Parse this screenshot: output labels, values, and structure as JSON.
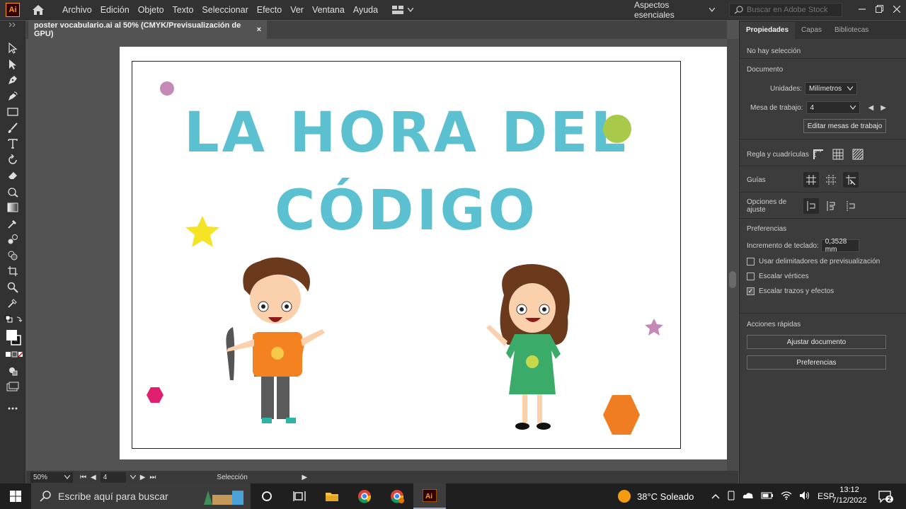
{
  "app": {
    "logo": "Ai"
  },
  "menu": [
    "Archivo",
    "Edición",
    "Objeto",
    "Texto",
    "Seleccionar",
    "Efecto",
    "Ver",
    "Ventana",
    "Ayuda"
  ],
  "workspace": "Aspectos esenciales",
  "stock_search": {
    "placeholder": "Buscar en Adobe Stock"
  },
  "document_tab": {
    "title": "poster vocabulario.ai al 50% (CMYK/Previsualización de GPU)",
    "close": "×"
  },
  "artboard": {
    "title_line1": "LA HORA DEL",
    "title_line2": "CÓDIGO",
    "colors": {
      "title": "#5bc0d0",
      "green_circle": "#a8c94a",
      "purple": "#c48ab5",
      "yellow_star": "#f5e326",
      "orange_hex": "#f07d22",
      "pink_hex": "#e0206e"
    }
  },
  "status": {
    "zoom": "50%",
    "artboard_number": "4",
    "tool": "Selección"
  },
  "panel": {
    "tabs": [
      "Propiedades",
      "Capas",
      "Bibliotecas"
    ],
    "selection_state": "No hay selección",
    "document": {
      "title": "Documento",
      "units_label": "Unidades:",
      "units_value": "Milímetros",
      "artboard_label": "Mesa de trabajo:",
      "artboard_value": "4",
      "edit_button": "Editar mesas de trabajo"
    },
    "rulers_label": "Regla y cuadrículas",
    "guides_label": "Guías",
    "snap_label": "Opciones de ajuste",
    "preferences": {
      "title": "Preferencias",
      "keyboard_increment_label": "Incremento de teclado:",
      "keyboard_increment_value": "0,3528 mm",
      "checkboxes": [
        {
          "label": "Usar delimitadores de previsualización",
          "checked": false
        },
        {
          "label": "Escalar vértices",
          "checked": false
        },
        {
          "label": "Escalar trazos y efectos",
          "checked": true
        }
      ]
    },
    "quick_actions": {
      "title": "Acciones rápidas",
      "fit_document": "Ajustar documento",
      "preferences": "Preferencias"
    }
  },
  "taskbar": {
    "search_placeholder": "Escribe aquí para buscar",
    "weather": "38°C  Soleado",
    "language": "ESP",
    "time": "13:12",
    "date": "7/12/2022",
    "notification_count": "2"
  }
}
